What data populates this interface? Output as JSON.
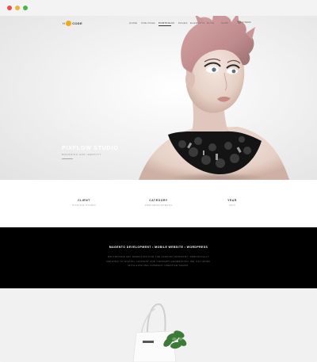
{
  "window": {
    "controls": [
      "close",
      "minimize",
      "maximize"
    ]
  },
  "nav": {
    "logo_left": "H",
    "logo_right": "CODE",
    "items": [
      "HOME",
      "ONE PAGE",
      "PORTFOLIO",
      "PAGES",
      "ELEMENTS",
      "BLOG",
      "SHOP"
    ],
    "active": "PORTFOLIO",
    "cart_label": "0 ITEMS",
    "cart_icon": "cart-icon"
  },
  "hero": {
    "title": "PIXFLOW STUDIO",
    "subtitle": "BRANDING AND IDENTITY"
  },
  "info": [
    {
      "label": "CLIENT",
      "value": "PIXFLOW STUDIO"
    },
    {
      "label": "CATEGORY",
      "value": "WEB DEVELOPMENT"
    },
    {
      "label": "YEAR",
      "value": "2015"
    }
  ],
  "band": {
    "title": "MAGENTO DEVELOPMENT • MOBILE WEBSITE • WORDPRESS",
    "text": "WE PROVIDE ART DIRECTION FOR THE FASHION INDUSTRY, SPECIFICALLY RELATED TO DIGITAL CONTENT AND CONCEPT GENERATION. WE CAN WORK WITH EXISTING COMPANY CREATIVE TEAMS."
  },
  "colors": {
    "accent": "#f0a81c",
    "band_bg": "#000000",
    "hero_title": "#ffffff",
    "close": "#ec4b4b",
    "minimize": "#e9b53a",
    "maximize": "#4bb443"
  }
}
